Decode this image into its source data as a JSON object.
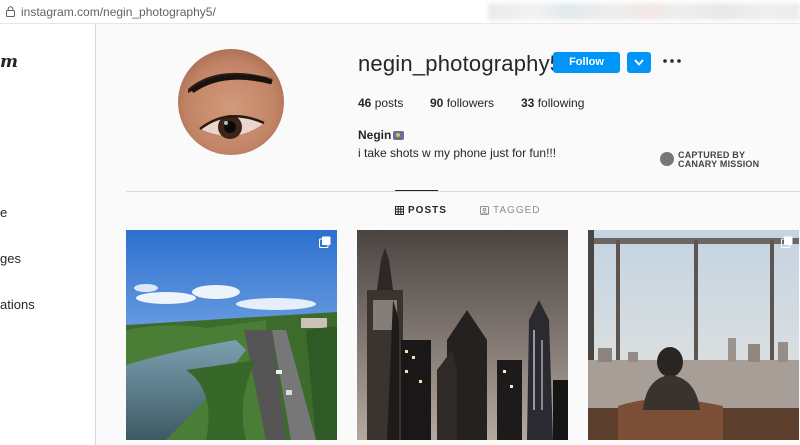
{
  "browser": {
    "url": "instagram.com/negin_photography5/"
  },
  "sidebar": {
    "logo": "m",
    "items": [
      {
        "label": "e"
      },
      {
        "label": "ges"
      },
      {
        "label": "ations"
      }
    ]
  },
  "profile": {
    "username": "negin_photography5",
    "follow_label": "Follow",
    "stats": [
      {
        "count": "46",
        "label": "posts"
      },
      {
        "count": "90",
        "label": "followers"
      },
      {
        "count": "33",
        "label": "following"
      }
    ],
    "full_name": "Negin",
    "bio": "i take shots w my phone just for fun!!!"
  },
  "watermark": {
    "line1": "CAPTURED BY",
    "line2": "CANARY MISSION"
  },
  "tabs": [
    {
      "label": "POSTS",
      "active": true
    },
    {
      "label": "TAGGED",
      "active": false
    }
  ],
  "colors": {
    "accent": "#0095f6",
    "text": "#262626",
    "muted": "#8e8e8e"
  },
  "icons": [
    "lock-icon",
    "chevron-down-icon",
    "more-options-icon",
    "grid-icon",
    "tag-icon",
    "multiple-posts-icon",
    "camera-emoji"
  ]
}
